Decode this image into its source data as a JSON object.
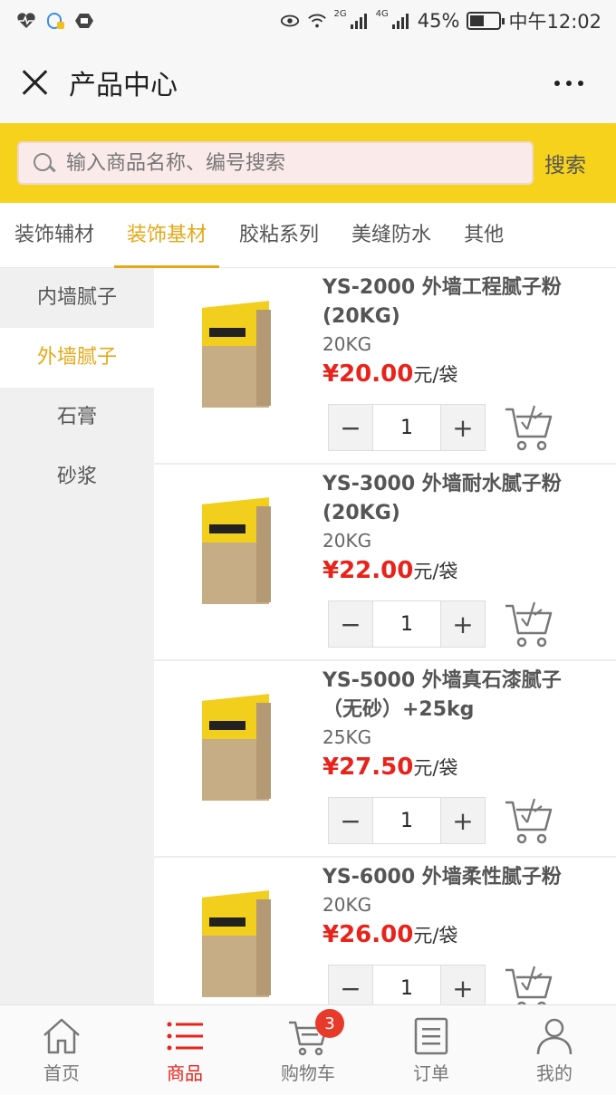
{
  "status_bar": {
    "network_labels": [
      "2G",
      "4G"
    ],
    "battery": "45%",
    "time": "中午12:02",
    "battery_level": 0.45
  },
  "titlebar": {
    "title": "产品中心"
  },
  "search": {
    "placeholder": "输入商品名称、编号搜索",
    "button": "搜索"
  },
  "tabs": [
    {
      "label": "装饰辅材",
      "active": false
    },
    {
      "label": "装饰基材",
      "active": true
    },
    {
      "label": "胶粘系列",
      "active": false
    },
    {
      "label": "美缝防水",
      "active": false
    },
    {
      "label": "其他",
      "active": false
    }
  ],
  "sidebar": [
    {
      "label": "内墙腻子",
      "active": false
    },
    {
      "label": "外墙腻子",
      "active": true
    },
    {
      "label": "石膏",
      "active": false
    },
    {
      "label": "砂浆",
      "active": false
    }
  ],
  "products": [
    {
      "name": "YS-2000 外墙工程腻子粉(20KG)",
      "spec": "20KG",
      "price": "¥20.00",
      "unit": "元/袋",
      "qty": "1",
      "minus": "−",
      "plus": "+"
    },
    {
      "name": "YS-3000 外墙耐水腻子粉(20KG)",
      "spec": "20KG",
      "price": "¥22.00",
      "unit": "元/袋",
      "qty": "1",
      "minus": "−",
      "plus": "+"
    },
    {
      "name": "YS-5000 外墙真石漆腻子（无砂）+25kg",
      "spec": "25KG",
      "price": "¥27.50",
      "unit": "元/袋",
      "qty": "1",
      "minus": "−",
      "plus": "+"
    },
    {
      "name": "YS-6000 外墙柔性腻子粉",
      "spec": "20KG",
      "price": "¥26.00",
      "unit": "元/袋",
      "qty": "1",
      "minus": "−",
      "plus": "+"
    }
  ],
  "bottom_nav": [
    {
      "label": "首页",
      "icon": "home-icon",
      "active": false
    },
    {
      "label": "商品",
      "icon": "list-icon",
      "active": true
    },
    {
      "label": "购物车",
      "icon": "cart-icon",
      "active": false,
      "badge": "3"
    },
    {
      "label": "订单",
      "icon": "order-icon",
      "active": false
    },
    {
      "label": "我的",
      "icon": "user-icon",
      "active": false
    }
  ],
  "colors": {
    "accent": "#f7d21c",
    "tab_active": "#e6a817",
    "price": "#e8231b",
    "nav_active": "#e8231b"
  }
}
